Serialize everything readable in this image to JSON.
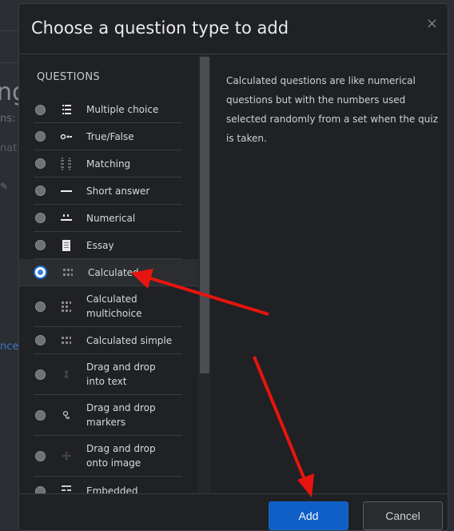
{
  "background": {
    "heading_fragment": "ng",
    "text_fragment_1": "ns: C",
    "text_fragment_2": "nat",
    "link_fragment": "nce"
  },
  "modal": {
    "title": "Choose a question type to add",
    "close_glyph": "×"
  },
  "questions": {
    "section_title": "QUESTIONS",
    "selected_index": 6,
    "items": [
      {
        "label": "Multiple choice",
        "icon": "multiple-choice-icon"
      },
      {
        "label": "True/False",
        "icon": "true-false-icon"
      },
      {
        "label": "Matching",
        "icon": "matching-icon"
      },
      {
        "label": "Short answer",
        "icon": "short-answer-icon"
      },
      {
        "label": "Numerical",
        "icon": "numerical-icon"
      },
      {
        "label": "Essay",
        "icon": "essay-icon"
      },
      {
        "label": "Calculated",
        "icon": "calculated-icon"
      },
      {
        "label": "Calculated multichoice",
        "icon": "calculated-multichoice-icon"
      },
      {
        "label": "Calculated simple",
        "icon": "calculated-simple-icon"
      },
      {
        "label": "Drag and drop into text",
        "icon": "drag-drop-text-icon"
      },
      {
        "label": "Drag and drop markers",
        "icon": "drag-drop-markers-icon"
      },
      {
        "label": "Drag and drop onto image",
        "icon": "drag-drop-image-icon"
      },
      {
        "label": "Embedded",
        "icon": "embedded-icon"
      }
    ]
  },
  "description": "Calculated questions are like numerical questions but with the numbers used selected randomly from a set when the quiz is taken.",
  "footer": {
    "add_label": "Add",
    "cancel_label": "Cancel"
  },
  "colors": {
    "accent": "#0f5fc7",
    "annotation_arrow": "#e8140f"
  }
}
